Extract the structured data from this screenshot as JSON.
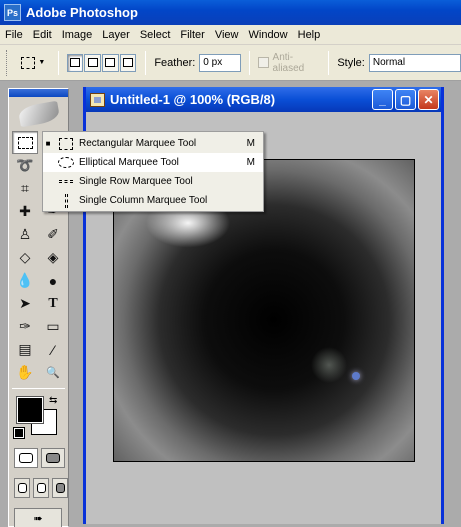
{
  "app": {
    "title": "Adobe Photoshop",
    "logo": "Ps"
  },
  "menubar": {
    "items": [
      "File",
      "Edit",
      "Image",
      "Layer",
      "Select",
      "Filter",
      "View",
      "Window",
      "Help"
    ]
  },
  "options": {
    "feather_label": "Feather:",
    "feather_value": "0 px",
    "antialiased_label": "Anti-aliased",
    "style_label": "Style:",
    "style_value": "Normal"
  },
  "document": {
    "title": "Untitled-1 @ 100% (RGB/8)"
  },
  "flyout": {
    "items": [
      {
        "label": "Rectangular Marquee Tool",
        "shortcut": "M",
        "icon": "rectangular-marquee-icon",
        "current": true
      },
      {
        "label": "Elliptical Marquee Tool",
        "shortcut": "M",
        "icon": "elliptical-marquee-icon",
        "current": false
      },
      {
        "label": "Single Row Marquee Tool",
        "shortcut": "",
        "icon": "single-row-marquee-icon",
        "current": false
      },
      {
        "label": "Single Column Marquee Tool",
        "shortcut": "",
        "icon": "single-column-marquee-icon",
        "current": false
      }
    ],
    "current_marker": "■"
  },
  "toolbox": {
    "tools": [
      {
        "name": "marquee-tool-icon",
        "glyph": ""
      },
      {
        "name": "move-tool-icon",
        "glyph": "✥"
      },
      {
        "name": "lasso-tool-icon",
        "glyph": "➰"
      },
      {
        "name": "magic-wand-tool-icon",
        "glyph": "✧"
      },
      {
        "name": "crop-tool-icon",
        "glyph": "⌗"
      },
      {
        "name": "slice-tool-icon",
        "glyph": "✎"
      },
      {
        "name": "healing-brush-icon",
        "glyph": "✚"
      },
      {
        "name": "brush-tool-icon",
        "glyph": "✒"
      },
      {
        "name": "clone-stamp-icon",
        "glyph": "♙"
      },
      {
        "name": "history-brush-icon",
        "glyph": "✐"
      },
      {
        "name": "eraser-tool-icon",
        "glyph": "◇"
      },
      {
        "name": "paint-bucket-icon",
        "glyph": "◈"
      },
      {
        "name": "blur-tool-icon",
        "glyph": "💧"
      },
      {
        "name": "burn-tool-icon",
        "glyph": "●"
      },
      {
        "name": "path-selection-icon",
        "glyph": "➤"
      },
      {
        "name": "type-tool-icon",
        "glyph": "T"
      },
      {
        "name": "pen-tool-icon",
        "glyph": "✑"
      },
      {
        "name": "rectangle-tool-icon",
        "glyph": "▭"
      },
      {
        "name": "notes-tool-icon",
        "glyph": "▤"
      },
      {
        "name": "eyedropper-tool-icon",
        "glyph": "⁄"
      },
      {
        "name": "hand-tool-icon",
        "glyph": "✋"
      },
      {
        "name": "zoom-tool-icon",
        "glyph": "🔍"
      }
    ]
  },
  "colors": {
    "foreground": "#000000",
    "background": "#ffffff",
    "accent": "#0a4fd6"
  }
}
